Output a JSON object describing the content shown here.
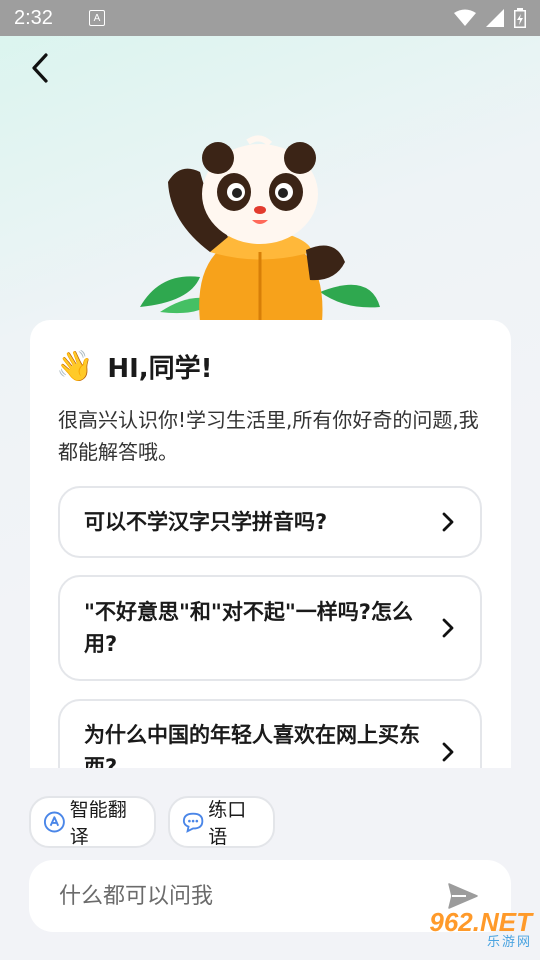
{
  "status_bar": {
    "time": "2:32",
    "a_icon_letter": "A"
  },
  "header": {
    "back_icon": "back-arrow-icon"
  },
  "greeting": {
    "emoji": "👋",
    "title": "HI,同学!",
    "intro": "很高兴认识你!学习生活里,所有你好奇的问题,我都能解答哦。"
  },
  "questions": [
    {
      "text": "可以不学汉字只学拼音吗?"
    },
    {
      "text": "\"不好意思\"和\"对不起\"一样吗?怎么用?"
    },
    {
      "text": "为什么中国的年轻人喜欢在网上买东西?"
    }
  ],
  "chips": {
    "translate": "智能翻译",
    "speak": "练口语"
  },
  "input": {
    "placeholder": "什么都可以问我"
  },
  "watermark": {
    "top": "962.NET",
    "bottom": "乐游网"
  },
  "colors": {
    "accent": "#4a86e8",
    "card": "#ffffff",
    "background": "#f2f3f7",
    "status_bar": "#9e9e9e"
  }
}
